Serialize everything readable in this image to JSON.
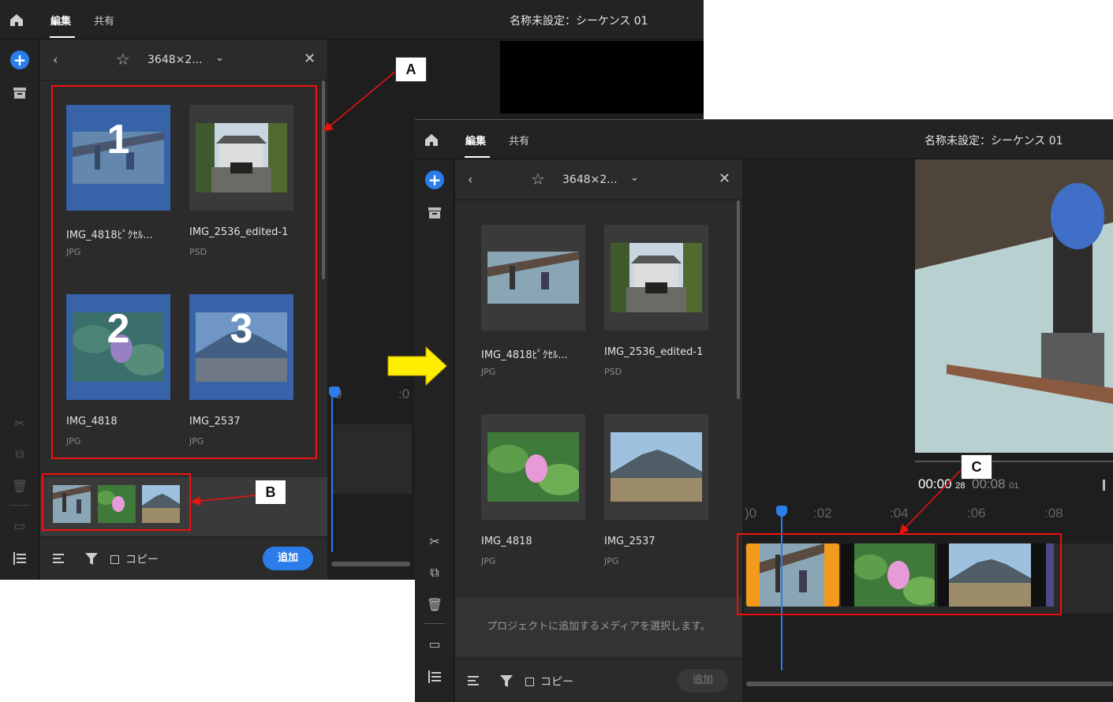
{
  "top": {
    "tabs": [
      "編集",
      "共有"
    ],
    "sequence_title": "名称未設定：シーケンス 01"
  },
  "panel": {
    "header_title": "3648×2...",
    "items": [
      {
        "name": "IMG_4818ﾋﾟｸｾﾙ...",
        "type": "JPG"
      },
      {
        "name": "IMG_2536_edited-1",
        "type": "PSD"
      },
      {
        "name": "IMG_4818",
        "type": "JPG"
      },
      {
        "name": "IMG_2537",
        "type": "JPG"
      }
    ],
    "selection_numbers": [
      "1",
      "2",
      "3"
    ],
    "copy_label": "コピー",
    "add_button": "追加",
    "hint_text": "プロジェクトに追加するメディアを選択します。"
  },
  "viewer": {
    "timecode_main": "00:00",
    "timecode_frames": "28",
    "timecode_end": "00:08",
    "timecode_end_frames": "01"
  },
  "ruler": {
    "labels_win1": [
      "0",
      ":0"
    ],
    "labels_win2": [
      ")0",
      ":02",
      ":04",
      ":06",
      ":08"
    ]
  },
  "callouts": [
    "A",
    "B",
    "C"
  ],
  "colors": {
    "accent": "#2b7de9",
    "selection": "#3763a8",
    "annotation": "#ee1111",
    "arrow": "#ffee00",
    "clip_selected": "#f39a1d"
  },
  "icons": [
    "home-icon",
    "plus-icon",
    "archive-icon",
    "back-icon",
    "star-icon",
    "chevron-down-icon",
    "close-icon",
    "scissors-icon",
    "duplicate-icon",
    "trash-icon",
    "tracks-icon",
    "timeline-icon",
    "sort-icon",
    "filter-icon"
  ]
}
